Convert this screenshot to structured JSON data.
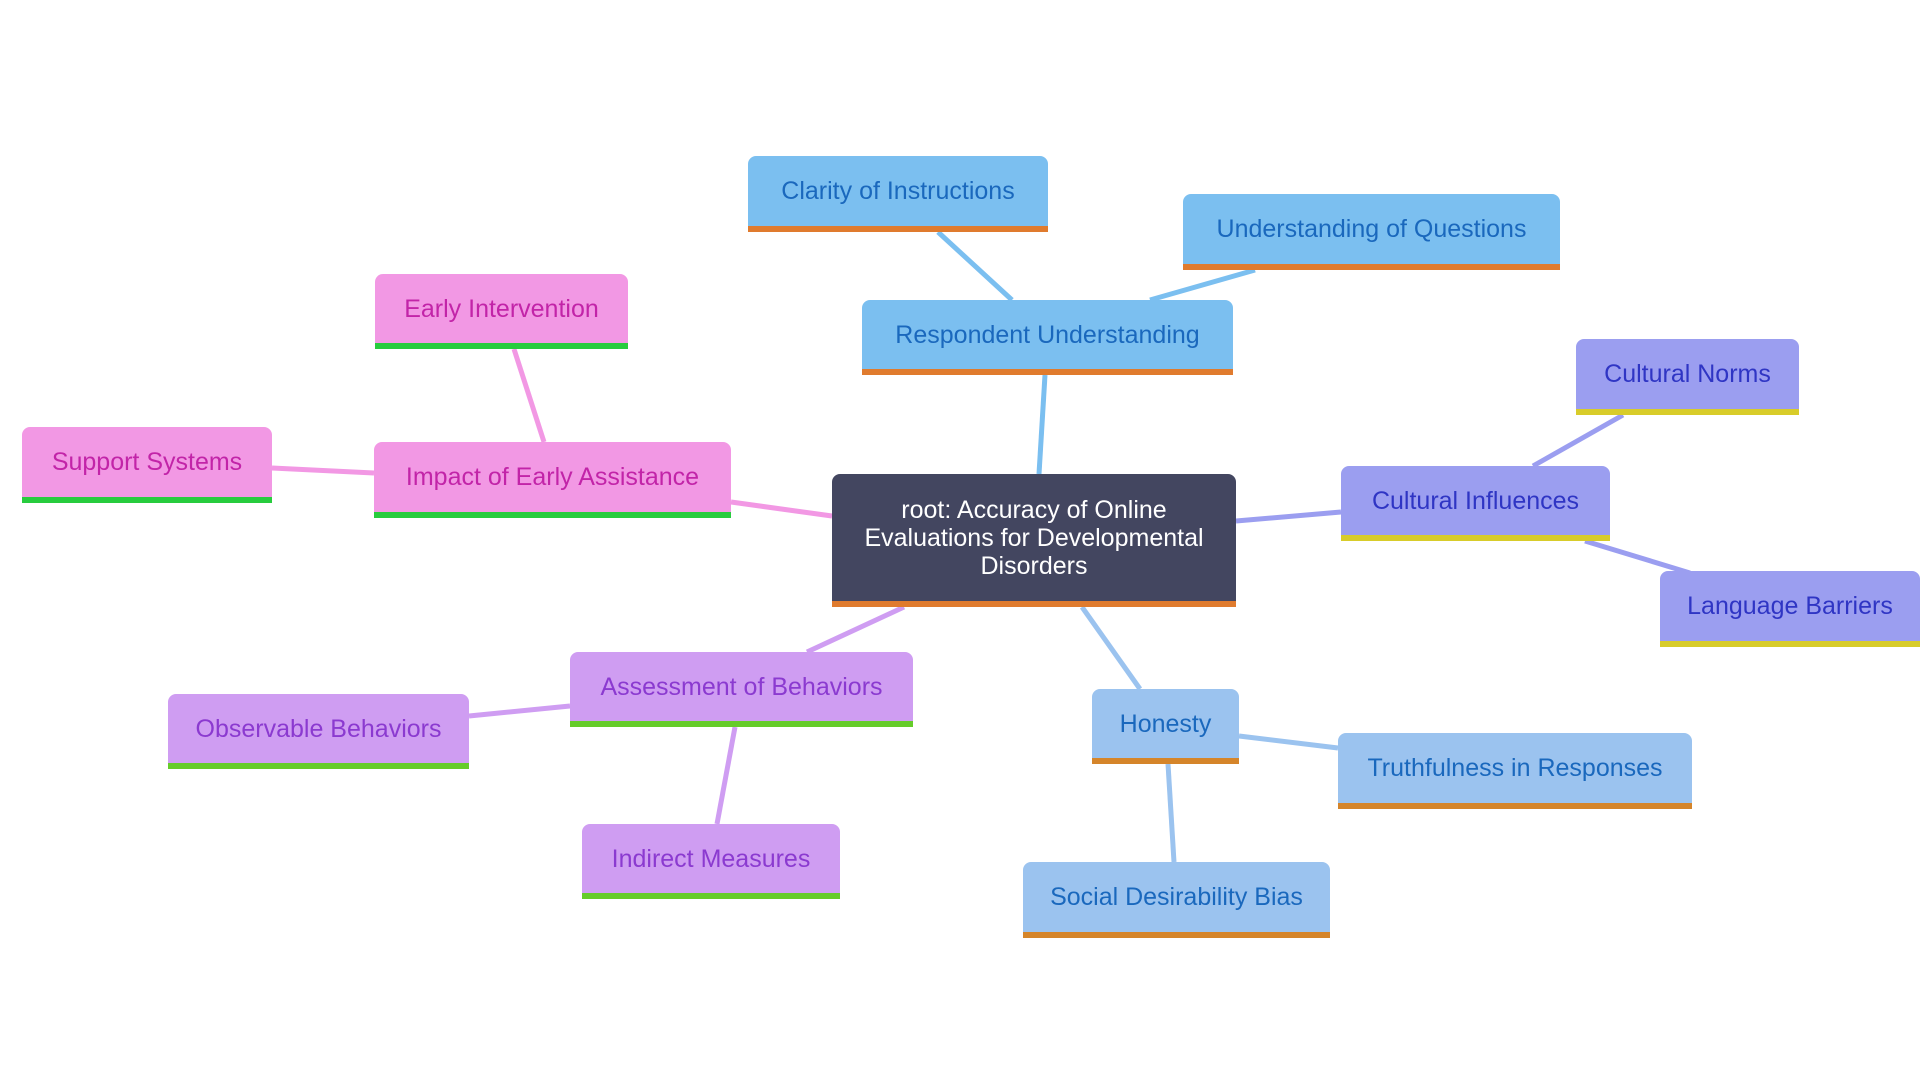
{
  "diagram": {
    "type": "mindmap",
    "root": {
      "id": "root",
      "label": "root: Accuracy of Online Evaluations for Developmental Disorders",
      "fill": "#434660",
      "text_color": "#ffffff",
      "underline": "#e07b2e"
    },
    "branches": [
      {
        "id": "respondent",
        "label": "Respondent Understanding",
        "fill": "#7bbff0",
        "text_color": "#1a68bd",
        "underline": "#e07b2e",
        "edge": "#7bbff0",
        "children": [
          {
            "id": "clarity",
            "label": "Clarity of Instructions"
          },
          {
            "id": "questions",
            "label": "Understanding of Questions"
          }
        ]
      },
      {
        "id": "cultural",
        "label": "Cultural Influences",
        "fill": "#9b9ef0",
        "text_color": "#2f35c4",
        "underline": "#d8cc2a",
        "edge": "#9b9ef0",
        "children": [
          {
            "id": "norms",
            "label": "Cultural Norms"
          },
          {
            "id": "language",
            "label": "Language Barriers"
          }
        ]
      },
      {
        "id": "honesty",
        "label": "Honesty",
        "fill": "#9bc3ef",
        "text_color": "#1a68bd",
        "underline": "#d5852a",
        "edge": "#9bc3ef",
        "children": [
          {
            "id": "truth",
            "label": "Truthfulness in Responses"
          },
          {
            "id": "social",
            "label": "Social Desirability Bias"
          }
        ]
      },
      {
        "id": "assessment",
        "label": "Assessment of Behaviors",
        "fill": "#cf9df2",
        "text_color": "#8b3ad0",
        "underline": "#66cc2a",
        "edge": "#cf9df2",
        "children": [
          {
            "id": "observable",
            "label": "Observable Behaviors"
          },
          {
            "id": "indirect",
            "label": "Indirect Measures"
          }
        ]
      },
      {
        "id": "impact",
        "label": "Impact of Early Assistance",
        "fill": "#f298e4",
        "text_color": "#c224a8",
        "underline": "#28cc3e",
        "edge": "#f298e4",
        "children": [
          {
            "id": "early",
            "label": "Early Intervention"
          },
          {
            "id": "support",
            "label": "Support Systems"
          }
        ]
      }
    ]
  }
}
